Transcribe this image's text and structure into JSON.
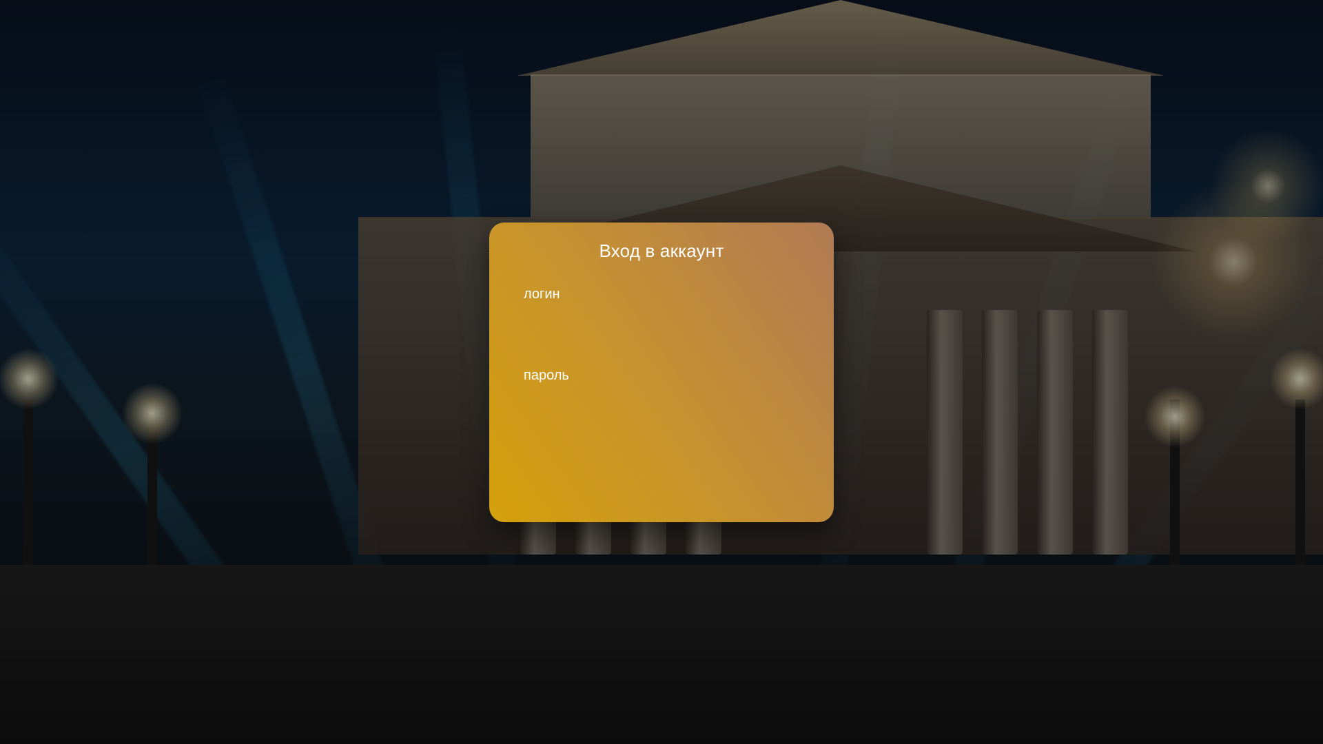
{
  "page": {
    "background_scene": "Bolshoi Theatre at night with light beams and fireworks",
    "overlay_dim": "dark translucent overlay"
  },
  "login": {
    "title": "Вход в аккаунт",
    "login_label": "логин",
    "login_value": "",
    "password_label": "пароль",
    "password_value": ""
  },
  "colors": {
    "card_gradient_start": "#d5a00a",
    "card_gradient_mid": "#c9952a",
    "card_gradient_end": "#b07a55",
    "text": "#ffffff"
  }
}
